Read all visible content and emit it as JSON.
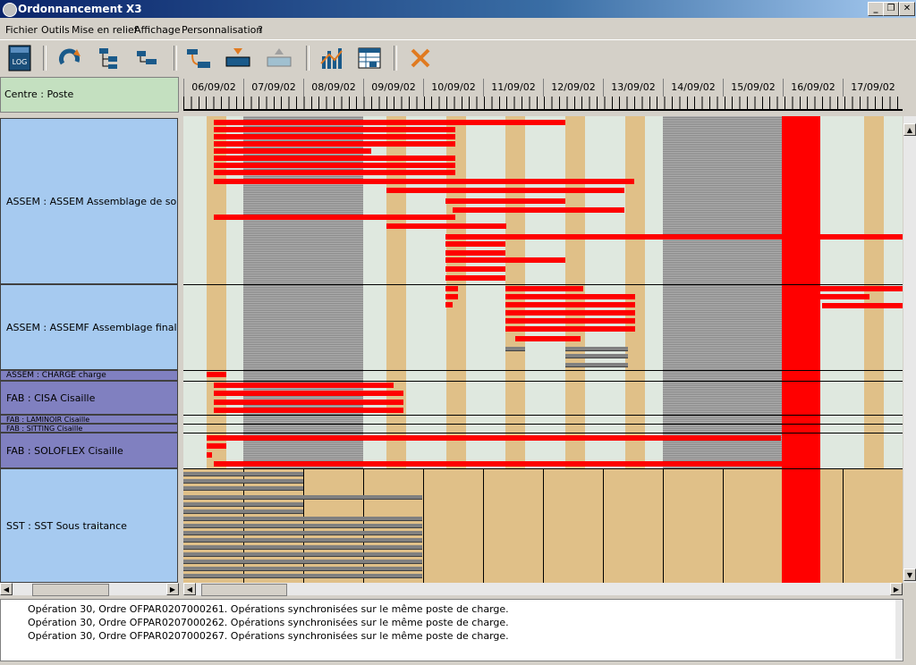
{
  "window": {
    "title": "Ordonnancement X3",
    "min_label": "_",
    "max_label": "❐",
    "close_label": "✕"
  },
  "menu": [
    {
      "label": "Fichier"
    },
    {
      "label": "Outils"
    },
    {
      "label": "Mise en relief"
    },
    {
      "label": "Affichage"
    },
    {
      "label": "Personnalisation"
    },
    {
      "label": "?"
    }
  ],
  "toolbar": {
    "icons": [
      "log-icon",
      "refresh-icon",
      "tree-expand-icon",
      "tree-collapse-icon",
      "move-icon",
      "down-arrow-icon",
      "up-arrow-icon",
      "bar-chart-icon",
      "table-chart-icon",
      "close-icon"
    ],
    "log_label": "LOG"
  },
  "header": {
    "centre_label": "Centre : Poste"
  },
  "dates": [
    "06/09/02",
    "07/09/02",
    "08/09/02",
    "09/09/02",
    "10/09/02",
    "11/09/02",
    "12/09/02",
    "13/09/02",
    "14/09/02",
    "15/09/02",
    "16/09/02",
    "17/09/02"
  ],
  "resources": [
    {
      "label": "ASSEM : ASSEM Assemblage de sous e"
    },
    {
      "label": "ASSEM : ASSEMF Assemblage final"
    },
    {
      "label": "ASSEM : CHARGE charge"
    },
    {
      "label": "FAB : CISA Cisaille"
    },
    {
      "label": "FAB : LAMINOIR Cisaille"
    },
    {
      "label": "FAB : SITTING Cisaille"
    },
    {
      "label": "FAB : SOLOFLEX Cisaille"
    },
    {
      "label": "SST : SST Sous traitance"
    }
  ],
  "colors": {
    "bar": "#ff0000",
    "weekend": "#909090",
    "workday": "#e0c088",
    "grid": "#dfe8df",
    "sst": "#e0c088"
  },
  "log": [
    "Opération 30, Ordre OFPAR0207000261. Opérations synchronisées sur le même poste de charge.",
    "Opération 30, Ordre OFPAR0207000262. Opérations synchronisées sur le même poste de charge.",
    "Opération 30, Ordre OFPAR0207000267. Opérations synchronisées sur le même poste de charge."
  ]
}
